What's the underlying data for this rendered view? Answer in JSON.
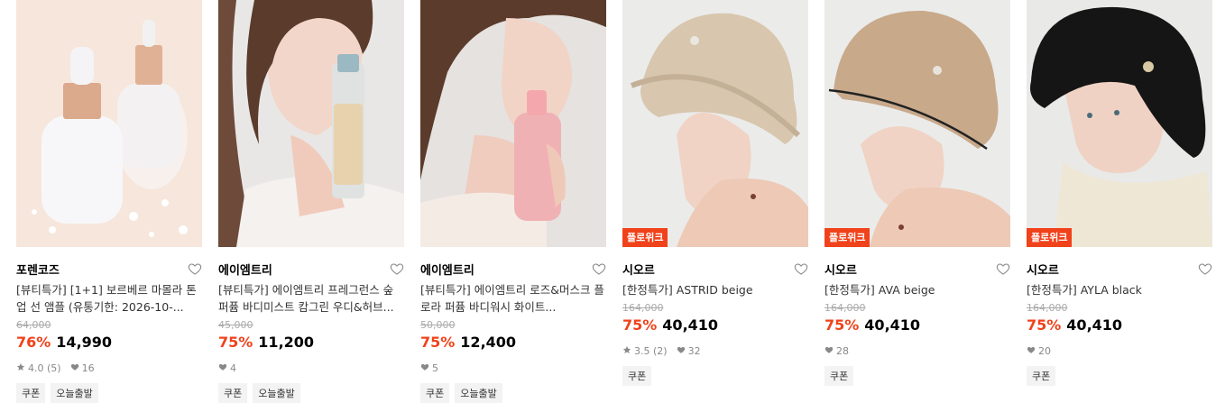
{
  "products": [
    {
      "brand": "포렌코즈",
      "name": "[뷰티특가] [1+1] 보르베르 마몰라 톤업 선 앰플 (유통기한: 2026-10-...",
      "original_price": "64,000",
      "discount": "76%",
      "price": "14,990",
      "rating": "4.0 (5)",
      "likes": "16",
      "badge": "",
      "tags": [
        "쿠폰",
        "오늘출발"
      ],
      "image": "serum-bottles"
    },
    {
      "brand": "에이엠트리",
      "name": "[뷰티특가] 에이엠트리 프레그런스 숲 퍼퓸 바디미스트 캄그린 우디&허브...",
      "original_price": "45,000",
      "discount": "75%",
      "price": "11,200",
      "rating": "",
      "likes": "4",
      "badge": "",
      "tags": [
        "쿠폰",
        "오늘출발"
      ],
      "image": "model-with-mist"
    },
    {
      "brand": "에이엠트리",
      "name": "[뷰티특가] 에이엠트리 로즈&머스크 플로라 퍼퓸 바디워시 화이트...",
      "original_price": "50,000",
      "discount": "75%",
      "price": "12,400",
      "rating": "",
      "likes": "5",
      "badge": "",
      "tags": [
        "쿠폰",
        "오늘출발"
      ],
      "image": "model-with-bodywash"
    },
    {
      "brand": "시오르",
      "name": "[한정특가] ASTRID beige",
      "original_price": "164,000",
      "discount": "75%",
      "price": "40,410",
      "rating": "3.5 (2)",
      "likes": "32",
      "badge": "플로위크",
      "tags": [
        "쿠폰"
      ],
      "image": "model-knit-hat-beige"
    },
    {
      "brand": "시오르",
      "name": "[한정특가] AVA beige",
      "original_price": "164,000",
      "discount": "75%",
      "price": "40,410",
      "rating": "",
      "likes": "28",
      "badge": "플로위크",
      "tags": [
        "쿠폰"
      ],
      "image": "model-crochet-hat-beige"
    },
    {
      "brand": "시오르",
      "name": "[한정특가] AYLA black",
      "original_price": "164,000",
      "discount": "75%",
      "price": "40,410",
      "rating": "",
      "likes": "20",
      "badge": "플로위크",
      "tags": [
        "쿠폰"
      ],
      "image": "model-crochet-hat-black"
    }
  ],
  "colors": {
    "accent": "#f0421b",
    "muted": "#888888"
  }
}
